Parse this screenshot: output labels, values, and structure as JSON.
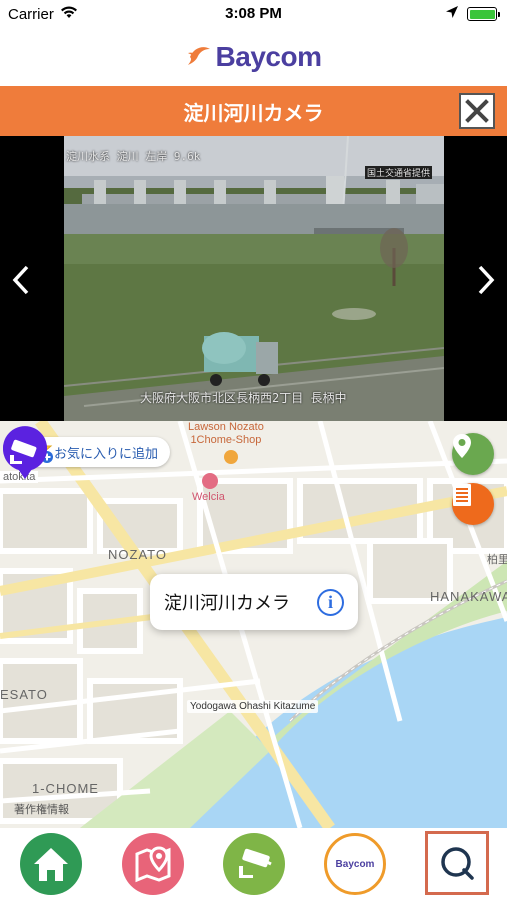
{
  "status_bar": {
    "carrier": "Carrier",
    "time": "3:08 PM"
  },
  "header": {
    "logo_text": "Baycom"
  },
  "title_bar": {
    "title": "淀川河川カメラ"
  },
  "camera": {
    "overlay_top": "淀川水系 淀川 左岸 9.6k",
    "overlay_agency": "国土交通省提供",
    "overlay_bottom": "大阪府大阪市北区長柄西2丁目 長柄中"
  },
  "map": {
    "favorite_label": "お気に入りに追加",
    "poi_lawson": "Lawson Nozato\n1Chome-Shop",
    "poi_welcia": "Welcia",
    "area_nozato": "NOZATO",
    "area_hanakawa": "HANAKAWA",
    "area_esato": "ESATO",
    "area_1chome": "1-CHOME",
    "area_atokita": "atokita",
    "area_kashiwa": "柏里",
    "copyright": "著作権情報",
    "callout_title": "淀川河川カメラ",
    "pin_label": "Yodogawa Ohashi Kitazume"
  },
  "icons": {
    "wifi": "wifi-icon",
    "location": "location-arrow-icon",
    "battery": "battery-icon",
    "close": "close-icon",
    "prev": "chevron-left-icon",
    "next": "chevron-right-icon",
    "star": "star-plus-icon",
    "pin": "map-pin-icon",
    "list": "list-icon",
    "info": "info-icon",
    "camera": "camera-icon",
    "home": "home-icon",
    "map": "map-icon",
    "cctv": "cctv-icon",
    "search": "search-icon"
  },
  "colors": {
    "accent_orange": "#ef7c3b",
    "logo_purple": "#4b3fa0",
    "pin_purple": "#5b22e0",
    "home_green": "#2f9a55",
    "map_pink": "#e86479",
    "cctv_green": "#7fb547",
    "fab_green": "#6aa84f",
    "fab_orange": "#ee6a1c",
    "water": "#a9d6f5",
    "park": "#cde6b4"
  }
}
